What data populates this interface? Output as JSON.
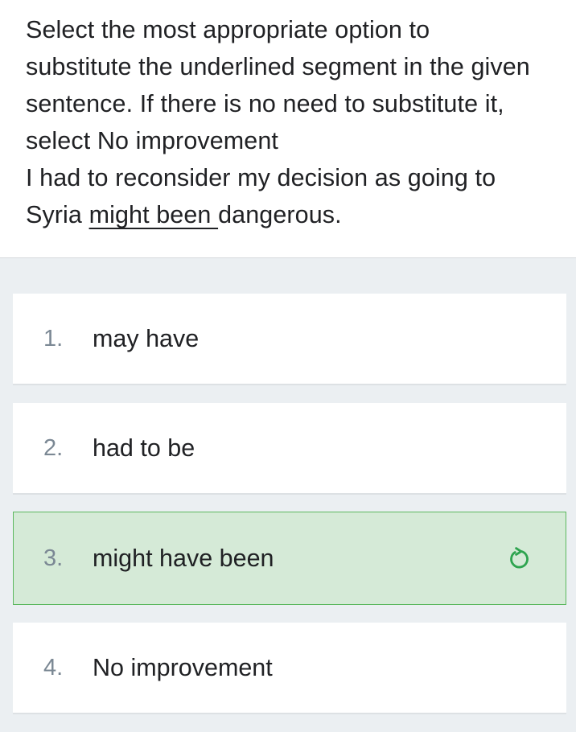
{
  "question": {
    "lines": [
      "Select the most appropriate option to",
      "substitute the underlined segment in the given",
      "sentence. If there is no need to substitute it,",
      "select No improvement",
      "I had to reconsider my decision as going to"
    ],
    "last_line_prefix": "Syria ",
    "underlined_segment": "might been ",
    "last_line_suffix": "dangerous."
  },
  "options": [
    {
      "number": "1.",
      "label": "may have",
      "selected": false
    },
    {
      "number": "2.",
      "label": "had to be",
      "selected": false
    },
    {
      "number": "3.",
      "label": "might have been",
      "selected": true
    },
    {
      "number": "4.",
      "label": "No improvement",
      "selected": false
    }
  ],
  "selected_icon": "retry-icon",
  "colors": {
    "selected_background": "#d5ead7",
    "selected_border": "#5cb85f",
    "icon_color": "#2ea44f"
  }
}
